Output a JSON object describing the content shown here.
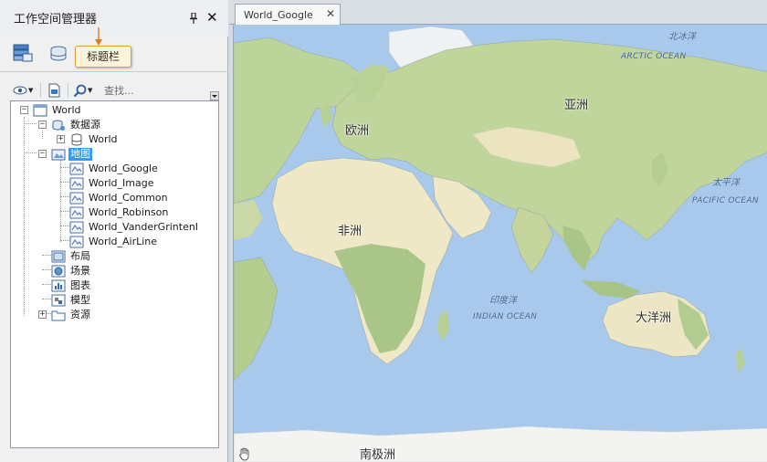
{
  "panel": {
    "title": "工作空间管理器",
    "callout": "标题栏",
    "search_placeholder": "查找..."
  },
  "tree": {
    "root": "World",
    "datasources": {
      "label": "数据源",
      "children": [
        "World"
      ]
    },
    "maps": {
      "label": "地图",
      "items": [
        "World_Google",
        "World_Image",
        "World_Common",
        "World_Robinson",
        "World_VanderGrintenI",
        "World_AirLine"
      ]
    },
    "layouts": "布局",
    "scenes": "场景",
    "charts": "图表",
    "models": "模型",
    "resources": "资源"
  },
  "document": {
    "tab_label": "World_Google",
    "tab_close": "✕"
  },
  "map_labels": {
    "europe": "欧洲",
    "asia": "亚洲",
    "africa": "非洲",
    "oceania": "大洋洲",
    "antarctica": "南极洲",
    "arctic_cn": "北冰洋",
    "arctic_en": "ARCTIC OCEAN",
    "pacific_cn": "太平洋",
    "pacific_en": "PACIFIC OCEAN",
    "indian_cn": "印度洋",
    "indian_en": "INDIAN OCEAN"
  },
  "colors": {
    "ocean": "#a9c9ec",
    "land_green": "#b9cf95",
    "land_desert": "#eee7c6",
    "selection": "#3399ff",
    "callout_border": "#e29d3f"
  }
}
